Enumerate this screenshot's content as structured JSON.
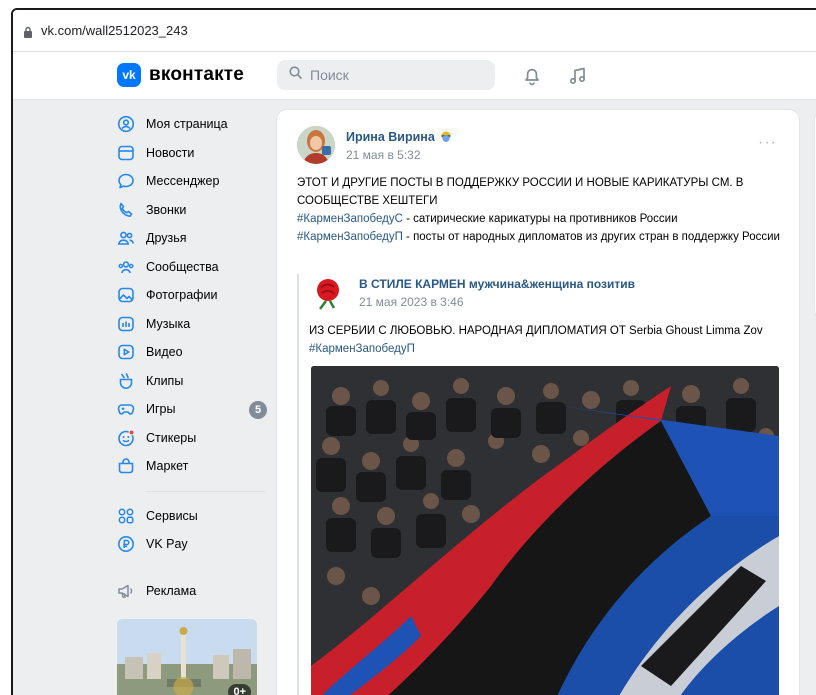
{
  "browser": {
    "url": "vk.com/wall2512023_243"
  },
  "header": {
    "logo_mark": "vk",
    "logo_text": "вконтакте",
    "search_placeholder": "Поиск",
    "icons": [
      "bell-icon",
      "music-icon"
    ]
  },
  "sidebar": {
    "items": [
      {
        "label": "Моя страница",
        "icon": "user-icon"
      },
      {
        "label": "Новости",
        "icon": "news-icon"
      },
      {
        "label": "Мессенджер",
        "icon": "messenger-icon"
      },
      {
        "label": "Звонки",
        "icon": "phone-icon"
      },
      {
        "label": "Друзья",
        "icon": "friends-icon"
      },
      {
        "label": "Сообщества",
        "icon": "communities-icon"
      },
      {
        "label": "Фотографии",
        "icon": "photos-icon"
      },
      {
        "label": "Музыка",
        "icon": "music-icon"
      },
      {
        "label": "Видео",
        "icon": "video-icon"
      },
      {
        "label": "Клипы",
        "icon": "clips-icon"
      },
      {
        "label": "Игры",
        "icon": "games-icon",
        "badge": "5"
      },
      {
        "label": "Стикеры",
        "icon": "stickers-icon"
      },
      {
        "label": "Маркет",
        "icon": "market-icon"
      }
    ],
    "items2": [
      {
        "label": "Сервисы",
        "icon": "services-icon"
      },
      {
        "label": "VK Pay",
        "icon": "vkpay-icon"
      }
    ],
    "items3": [
      {
        "label": "Реклама",
        "icon": "ads-icon"
      }
    ],
    "promo_count": "0+"
  },
  "post": {
    "author": "Ирина Вирина",
    "time": "21 мая в 5:32",
    "menu": "···",
    "line1": "ЭТОТ И ДРУГИЕ ПОСТЫ В ПОДДЕРЖКУ РОССИИ И НОВЫЕ КАРИКАТУРЫ СМ. В СООБЩЕСТВЕ ХЕШТЕГИ",
    "tag1": "#КарменЗапобедуС",
    "tag1_text": " - сатирические карикатуры на противников России",
    "tag2": "#КарменЗапобедуП",
    "tag2_text": " - посты от народных дипломатов из других стран в поддержку России"
  },
  "repost": {
    "author": "В СТИЛЕ КАРМЕН мужчина&женщина позитив",
    "time": "21 мая 2023 в 3:46",
    "text": "ИЗ СЕРБИИ С ЛЮБОВЬЮ. НАРОДНАЯ ДИПЛОМАТИЯ ОТ Serbia Ghoust Limma Zov",
    "tag": "#КарменЗапобедуП"
  },
  "colors": {
    "accent": "#0077ff",
    "link": "#2a5885",
    "muted": "#818c99",
    "page_bg": "#edeef0"
  }
}
